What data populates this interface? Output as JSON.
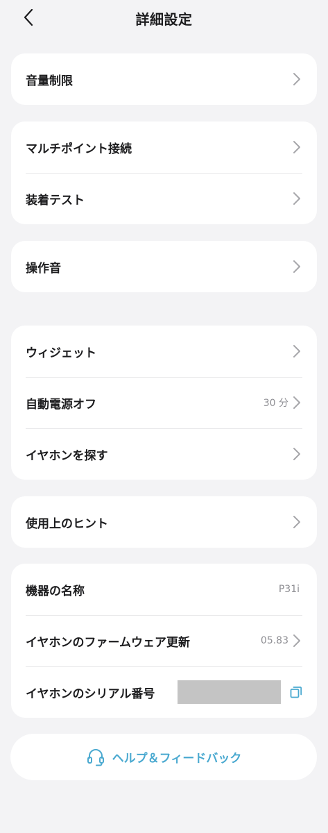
{
  "header": {
    "title": "詳細設定"
  },
  "sections": [
    {
      "items": [
        {
          "label": "音量制限"
        }
      ]
    },
    {
      "items": [
        {
          "label": "マルチポイント接続"
        },
        {
          "label": "装着テスト"
        }
      ]
    },
    {
      "items": [
        {
          "label": "操作音"
        }
      ]
    },
    {
      "items": [
        {
          "label": "ウィジェット"
        },
        {
          "label": "自動電源オフ",
          "value": "30 分"
        },
        {
          "label": "イヤホンを探す"
        }
      ]
    },
    {
      "items": [
        {
          "label": "使用上のヒント"
        }
      ]
    },
    {
      "items": [
        {
          "label": "機器の名称",
          "value": "P31i"
        },
        {
          "label": "イヤホンのファームウェア更新",
          "value": "05.83"
        },
        {
          "label": "イヤホンのシリアル番号"
        }
      ]
    }
  ],
  "help": {
    "label": "ヘルプ＆フィードバック"
  },
  "colors": {
    "accent": "#4aa9d0",
    "background": "#f3f3f5",
    "card": "#ffffff",
    "chevron": "#a7a7ab",
    "secondary_text": "#8e8e93"
  },
  "icons": {
    "back": "chevron-left-icon",
    "row_arrow": "chevron-right-icon",
    "copy": "copy-icon",
    "help": "headset-icon"
  }
}
